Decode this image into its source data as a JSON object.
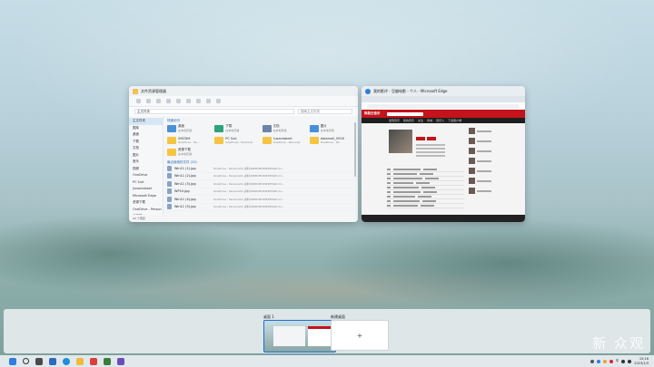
{
  "explorer": {
    "title": "文件资源管理器",
    "address": "主文件夹",
    "search_placeholder": "搜索主文件夹",
    "nav": [
      "主文件夹",
      "图库",
      "桌面",
      "下载",
      "文档",
      "图片",
      "音乐",
      "视频",
      "OneDrive",
      "PC Suit",
      "jiusanlabeel",
      "Microsoft Edge",
      "资源下载",
      "OneDrive - Person",
      "此电脑",
      "网络"
    ],
    "quick_access_label": "快速访问",
    "folders": [
      {
        "name": "桌面",
        "sub": "在本地存储",
        "color": "blue"
      },
      {
        "name": "下载",
        "sub": "在本地存储",
        "color": "green"
      },
      {
        "name": "文档",
        "sub": "在本地存储",
        "color": "gray"
      },
      {
        "name": "图片",
        "sub": "在本地存储",
        "color": "blue"
      },
      {
        "name": "SMZDM",
        "sub": "OneDrive - Pe...",
        "color": "yellow"
      },
      {
        "name": "PC Suit",
        "sub": "OneDrive - Personal",
        "color": "yellow"
      },
      {
        "name": "jiusanlabeel",
        "sub": "OneDrive - Personal",
        "color": "yellow"
      },
      {
        "name": "datamall_0926",
        "sub": "OneDrive - Pe...",
        "color": "yellow"
      },
      {
        "name": "资源下载",
        "sub": "在本地存储",
        "color": "yellow"
      }
    ],
    "recent_label": "最近使用的文件 (20)",
    "files": [
      {
        "name": "Win11 (1).jpg",
        "path": "OneDrive - Personal\\1.资料\\SMZDM\\SMZDM\\Win11..."
      },
      {
        "name": "Win11 (2).jpg",
        "path": "OneDrive - Personal\\1.资料\\SMZDM\\SMZDM\\Win11..."
      },
      {
        "name": "Win11 (3).jpg",
        "path": "OneDrive - Personal\\1.资料\\SMZDM\\SMZDM\\Win11..."
      },
      {
        "name": "WP10.jpg",
        "path": "OneDrive - Personal\\1.资料\\SMZDM\\SMZDM\\Win11..."
      },
      {
        "name": "Win11 (4).jpg",
        "path": "OneDrive - Personal\\1.资料\\SMZDM\\SMZDM\\Win11..."
      },
      {
        "name": "Win11 (5).jpg",
        "path": "OneDrive - Personal\\1.资料\\SMZDM\\SMZDM\\Win11..."
      }
    ],
    "status": "20 个项目"
  },
  "edge": {
    "title": "我的影评 - 豆瓣电影 - 个人 - Microsoft Edge",
    "site_logo": "网易云音乐",
    "nav": [
      "发现音乐",
      "我的音乐",
      "关注",
      "商城",
      "音乐人",
      "下载客户端"
    ]
  },
  "taskview": {
    "desktop1_label": "桌面 1",
    "desktop2_label": "新建桌面",
    "new_desktop_symbol": "+"
  },
  "taskbar": {
    "lang": "中",
    "time": "10:16",
    "date": "2023/1/3"
  },
  "watermark": "新 众观"
}
